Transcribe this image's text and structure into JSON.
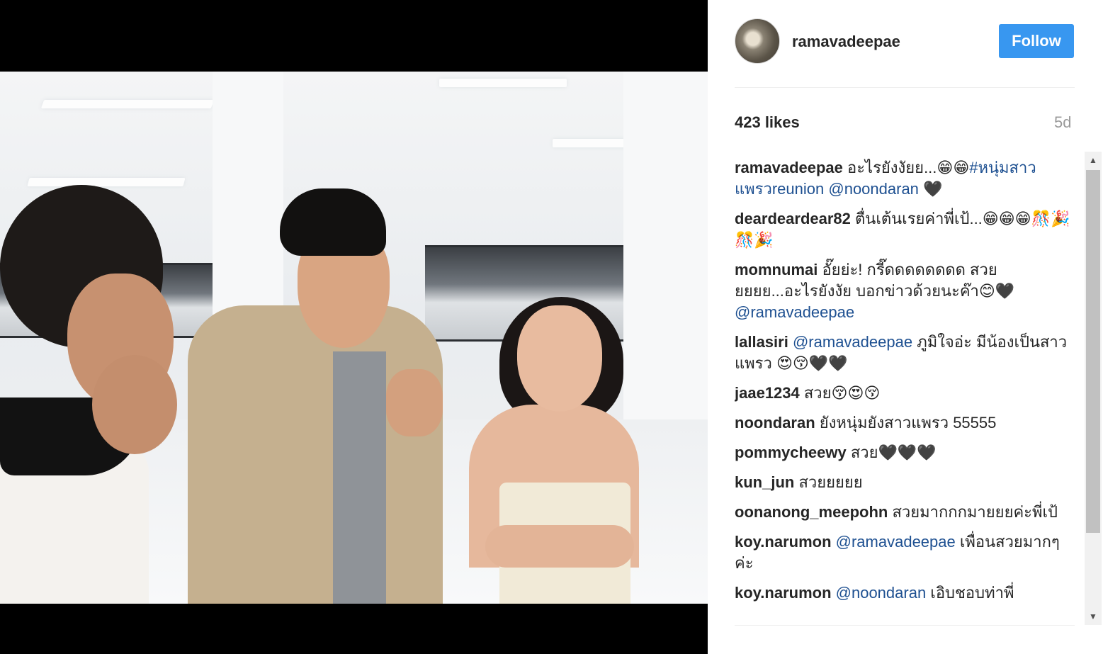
{
  "post": {
    "username": "ramavadeepae",
    "follow_label": "Follow",
    "likes": "423 likes",
    "age": "5d"
  },
  "comments": [
    {
      "user": "ramavadeepae",
      "parts": [
        {
          "t": " อะไรยังงัยย...😁😁"
        },
        {
          "t": "#หนุ่มสาวแพรว",
          "m": true
        },
        {
          "t": "reunion ",
          "m": true
        },
        {
          "t": "@noondaran",
          "m": true
        },
        {
          "t": " 🖤"
        }
      ]
    },
    {
      "user": "deardeardear82",
      "parts": [
        {
          "t": " ตื่นเต้นเรยค่าพี่เป้...😁😁😁🎊🎉🎊🎉"
        }
      ]
    },
    {
      "user": "momnumai",
      "parts": [
        {
          "t": " อั๊ยย่ะ! กรี๊ดดดดดดดด สวยยยยย...อะไรยังงัย บอกข่าวด้วยนะค๊า😊🖤 "
        },
        {
          "t": "@ramavadeepae",
          "m": true
        }
      ]
    },
    {
      "user": "lallasiri",
      "parts": [
        {
          "t": " "
        },
        {
          "t": "@ramavadeepae",
          "m": true
        },
        {
          "t": " ภูมิใจอ่ะ มีน้องเป็นสาวแพรว 😍😚🖤🖤"
        }
      ]
    },
    {
      "user": "jaae1234",
      "parts": [
        {
          "t": " สวย😚😍😚"
        }
      ]
    },
    {
      "user": "noondaran",
      "parts": [
        {
          "t": " ยังหนุ่มยังสาวแพรว 55555"
        }
      ]
    },
    {
      "user": "pommycheewy",
      "parts": [
        {
          "t": " สวย🖤🖤🖤"
        }
      ]
    },
    {
      "user": "kun_jun",
      "parts": [
        {
          "t": " สวยยยยย"
        }
      ]
    },
    {
      "user": "oonanong_meepohn",
      "parts": [
        {
          "t": " สวยมากกกมายยยค่ะพี่เป้"
        }
      ]
    },
    {
      "user": "koy.narumon",
      "parts": [
        {
          "t": " "
        },
        {
          "t": "@ramavadeepae",
          "m": true
        },
        {
          "t": " เพื่อนสวยมากๆค่ะ"
        }
      ]
    },
    {
      "user": "koy.narumon",
      "parts": [
        {
          "t": " "
        },
        {
          "t": "@noondaran",
          "m": true
        },
        {
          "t": " เอิบชอบท่าพี่"
        }
      ]
    }
  ],
  "icons": {
    "scroll_up": "scroll-up-arrow-icon",
    "scroll_down": "scroll-down-arrow-icon"
  },
  "colors": {
    "follow_bg": "#3897f0",
    "mention": "#1e5091",
    "muted": "#999999"
  }
}
